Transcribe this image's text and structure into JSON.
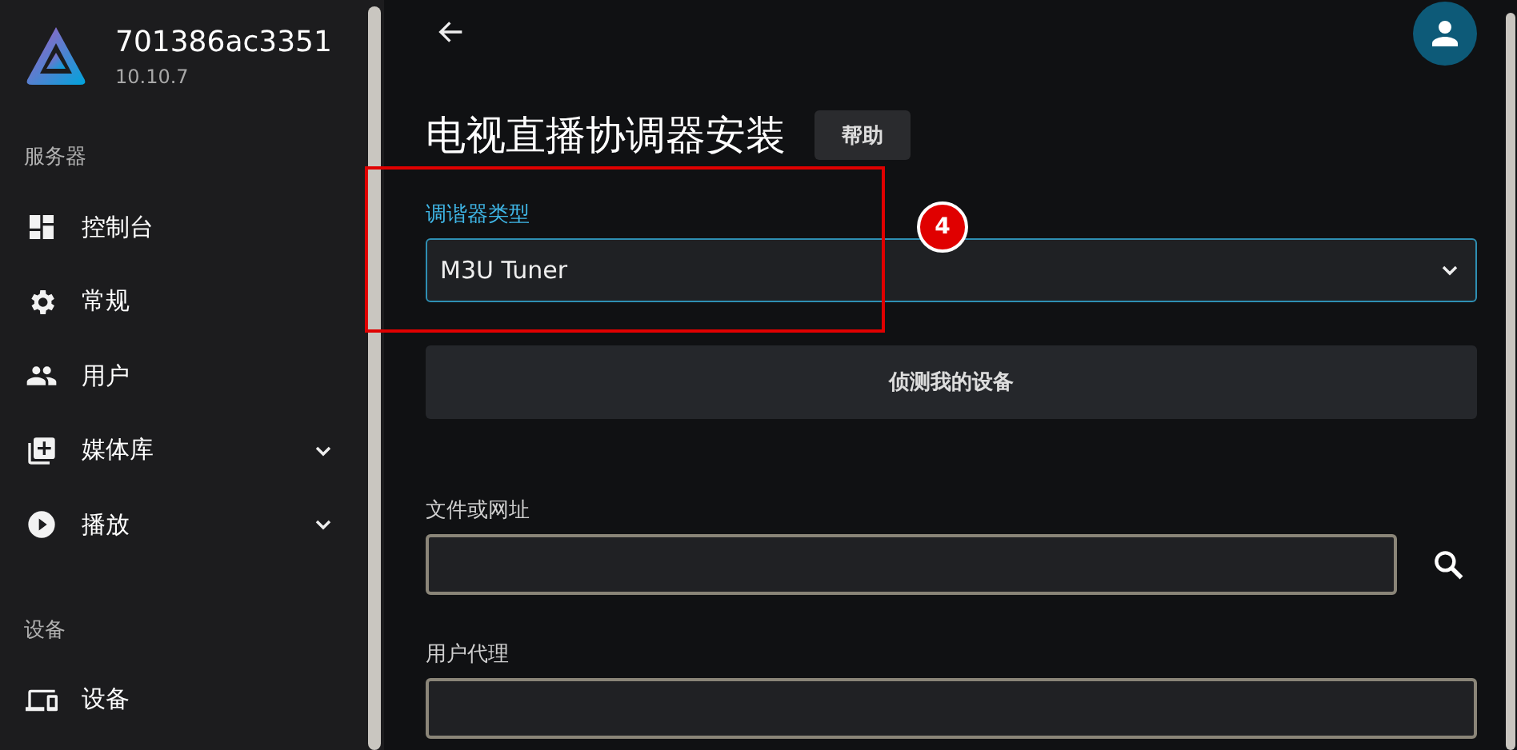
{
  "server": {
    "name": "701386ac3351",
    "version": "10.10.7"
  },
  "sidebar": {
    "sections": [
      {
        "title": "服务器",
        "items": [
          {
            "label": "控制台",
            "kind": "dashboard",
            "expandable": false
          },
          {
            "label": "常规",
            "kind": "gear",
            "expandable": false
          },
          {
            "label": "用户",
            "kind": "people",
            "expandable": false
          },
          {
            "label": "媒体库",
            "kind": "library",
            "expandable": true
          },
          {
            "label": "播放",
            "kind": "play",
            "expandable": true
          }
        ]
      },
      {
        "title": "设备",
        "items": [
          {
            "label": "设备",
            "kind": "devices",
            "expandable": false
          }
        ]
      }
    ]
  },
  "page": {
    "title": "电视直播协调器安装",
    "help_button": "帮助",
    "tuner_type": {
      "label": "调谐器类型",
      "value": "M3U Tuner"
    },
    "detect_button": "侦测我的设备",
    "file_or_url": {
      "label": "文件或网址"
    },
    "user_agent": {
      "label": "用户代理"
    }
  },
  "annotations": [
    {
      "kind": "box"
    },
    {
      "kind": "badge",
      "label": "4"
    }
  ]
}
